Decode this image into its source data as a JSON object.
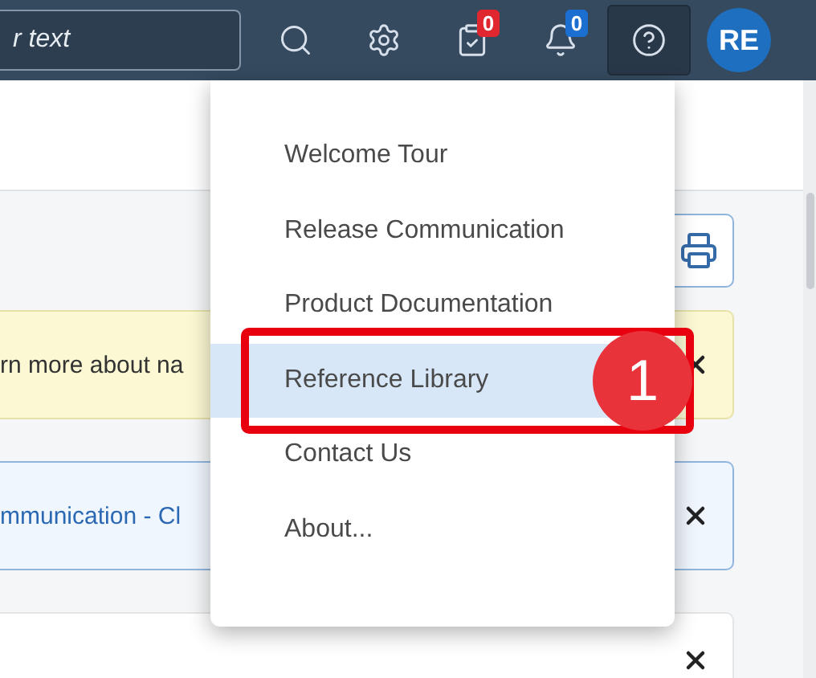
{
  "shell": {
    "search": {
      "placeholder": "r text"
    },
    "actions": [
      {
        "kind": "search",
        "selected": false
      },
      {
        "kind": "settings",
        "selected": false
      },
      {
        "kind": "tasks",
        "selected": false,
        "badge": "0",
        "color": "#e0262f"
      },
      {
        "kind": "notifications",
        "selected": false,
        "badge": "0",
        "color": "#1b6fd1"
      },
      {
        "kind": "help",
        "selected": true
      }
    ],
    "avatar": "RE"
  },
  "messages": [
    {
      "kind": "warning",
      "text": "rn more about na"
    },
    {
      "kind": "info",
      "text": "mmunication - Cl"
    },
    {
      "kind": "plain"
    }
  ],
  "help_menu": {
    "items": [
      {
        "label": "Welcome Tour",
        "selected": false
      },
      {
        "label": "Release Communication",
        "selected": false
      },
      {
        "label": "Product Documentation",
        "selected": false
      },
      {
        "label": "Reference Library",
        "selected": true
      },
      {
        "label": "Contact Us",
        "selected": false
      },
      {
        "label": "About...",
        "selected": false
      }
    ],
    "annotation": {
      "number": "1"
    }
  }
}
